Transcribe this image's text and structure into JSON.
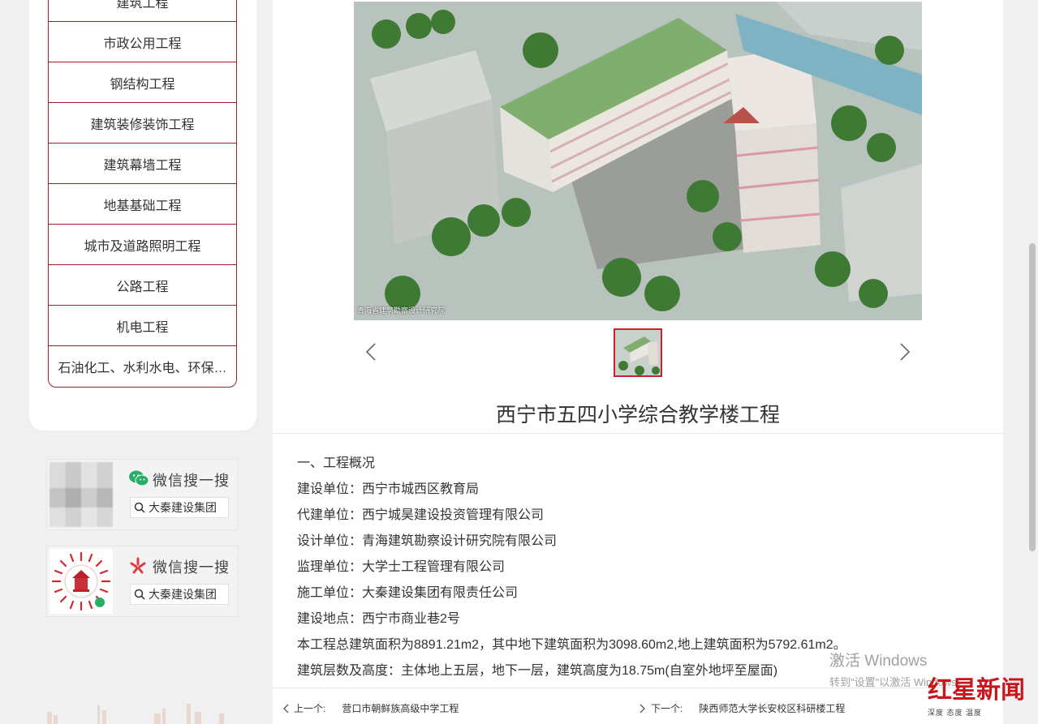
{
  "sidebar": {
    "items": [
      {
        "label": "建筑工程"
      },
      {
        "label": "市政公用工程"
      },
      {
        "label": "钢结构工程"
      },
      {
        "label": "建筑装修装饰工程"
      },
      {
        "label": "建筑幕墙工程"
      },
      {
        "label": "地基基础工程"
      },
      {
        "label": "城市及道路照明工程"
      },
      {
        "label": "公路工程"
      },
      {
        "label": "机电工程"
      },
      {
        "label": "石油化工、水利水电、环保…"
      }
    ]
  },
  "qr_cards": [
    {
      "title": "微信搜一搜",
      "search": "大秦建设集团",
      "icon": "wechat-icon"
    },
    {
      "title": "微信搜一搜",
      "search": "大秦建设集团",
      "icon": "weixin-search-icon"
    }
  ],
  "hero": {
    "caption": "青海省建筑勘察设计研究院"
  },
  "project": {
    "title": "西宁市五四小学综合教学楼工程",
    "lines": [
      "一、工程概况",
      "建设单位：西宁市城西区教育局",
      "代建单位：西宁城昊建设投资管理有限公司",
      "设计单位：青海建筑勘察设计研究院有限公司",
      "监理单位：大学士工程管理有限公司",
      "施工单位：大秦建设集团有限责任公司",
      "建设地点：西宁市商业巷2号",
      "本工程总建筑面积为8891.21m2，其中地下建筑面积为3098.60m2,地上建筑面积为5792.61m2。",
      "建筑层数及高度：主体地上五层，地下一层，建筑高度为18.75m(自室外地坪至屋面)"
    ]
  },
  "nav": {
    "prev_label": "上一个:",
    "prev_title": "营口市朝鲜族高级中学工程",
    "next_label": "下一个:",
    "next_title": "陕西师范大学长安校区科研楼工程"
  },
  "watermark": {
    "line1": "激活 Windows",
    "line2": "转到\"设置\"以激活 Windows。"
  },
  "news_logo": {
    "brand": "红星新闻",
    "slogan": "深度 态度 温度"
  },
  "colors": {
    "accent": "#a21f2a",
    "thumb_border": "#c8222e",
    "brand_red": "#c8161d"
  }
}
